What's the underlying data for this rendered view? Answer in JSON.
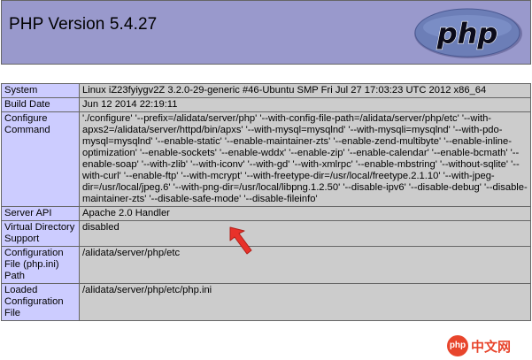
{
  "header": {
    "title": "PHP Version 5.4.27",
    "logo_text": "php",
    "colors": {
      "banner": "#9999cc",
      "logo": "#6c7eb7"
    }
  },
  "rows": [
    {
      "label": "System",
      "value": "Linux iZ23fyiygv2Z 3.2.0-29-generic #46-Ubuntu SMP Fri Jul 27 17:03:23 UTC 2012 x86_64"
    },
    {
      "label": "Build Date",
      "value": "Jun 12 2014 22:19:11"
    },
    {
      "label": "Configure Command",
      "value": "'./configure' '--prefix=/alidata/server/php' '--with-config-file-path=/alidata/server/php/etc' '--with-apxs2=/alidata/server/httpd/bin/apxs' '--with-mysql=mysqlnd' '--with-mysqli=mysqlnd' '--with-pdo-mysql=mysqlnd' '--enable-static' '--enable-maintainer-zts' '--enable-zend-multibyte' '--enable-inline-optimization' '--enable-sockets' '--enable-wddx' '--enable-zip' '--enable-calendar' '--enable-bcmath' '--enable-soap' '--with-zlib' '--with-iconv' '--with-gd' '--with-xmlrpc' '--enable-mbstring' '--without-sqlite' '--with-curl' '--enable-ftp' '--with-mcrypt' '--with-freetype-dir=/usr/local/freetype.2.1.10' '--with-jpeg-dir=/usr/local/jpeg.6' '--with-png-dir=/usr/local/libpng.1.2.50' '--disable-ipv6' '--disable-debug' '--disable-maintainer-zts' '--disable-safe-mode' '--disable-fileinfo'"
    },
    {
      "label": "Server API",
      "value": "Apache 2.0 Handler"
    },
    {
      "label": "Virtual Directory Support",
      "value": "disabled"
    },
    {
      "label": "Configuration File (php.ini) Path",
      "value": "/alidata/server/php/etc"
    },
    {
      "label": "Loaded Configuration File",
      "value": "/alidata/server/php/etc/php.ini"
    }
  ],
  "annotation": {
    "arrow_color": "#e8322a",
    "arrow_icon": "red-arrow-icon"
  },
  "watermark": {
    "badge": "php",
    "text": "中文网"
  }
}
